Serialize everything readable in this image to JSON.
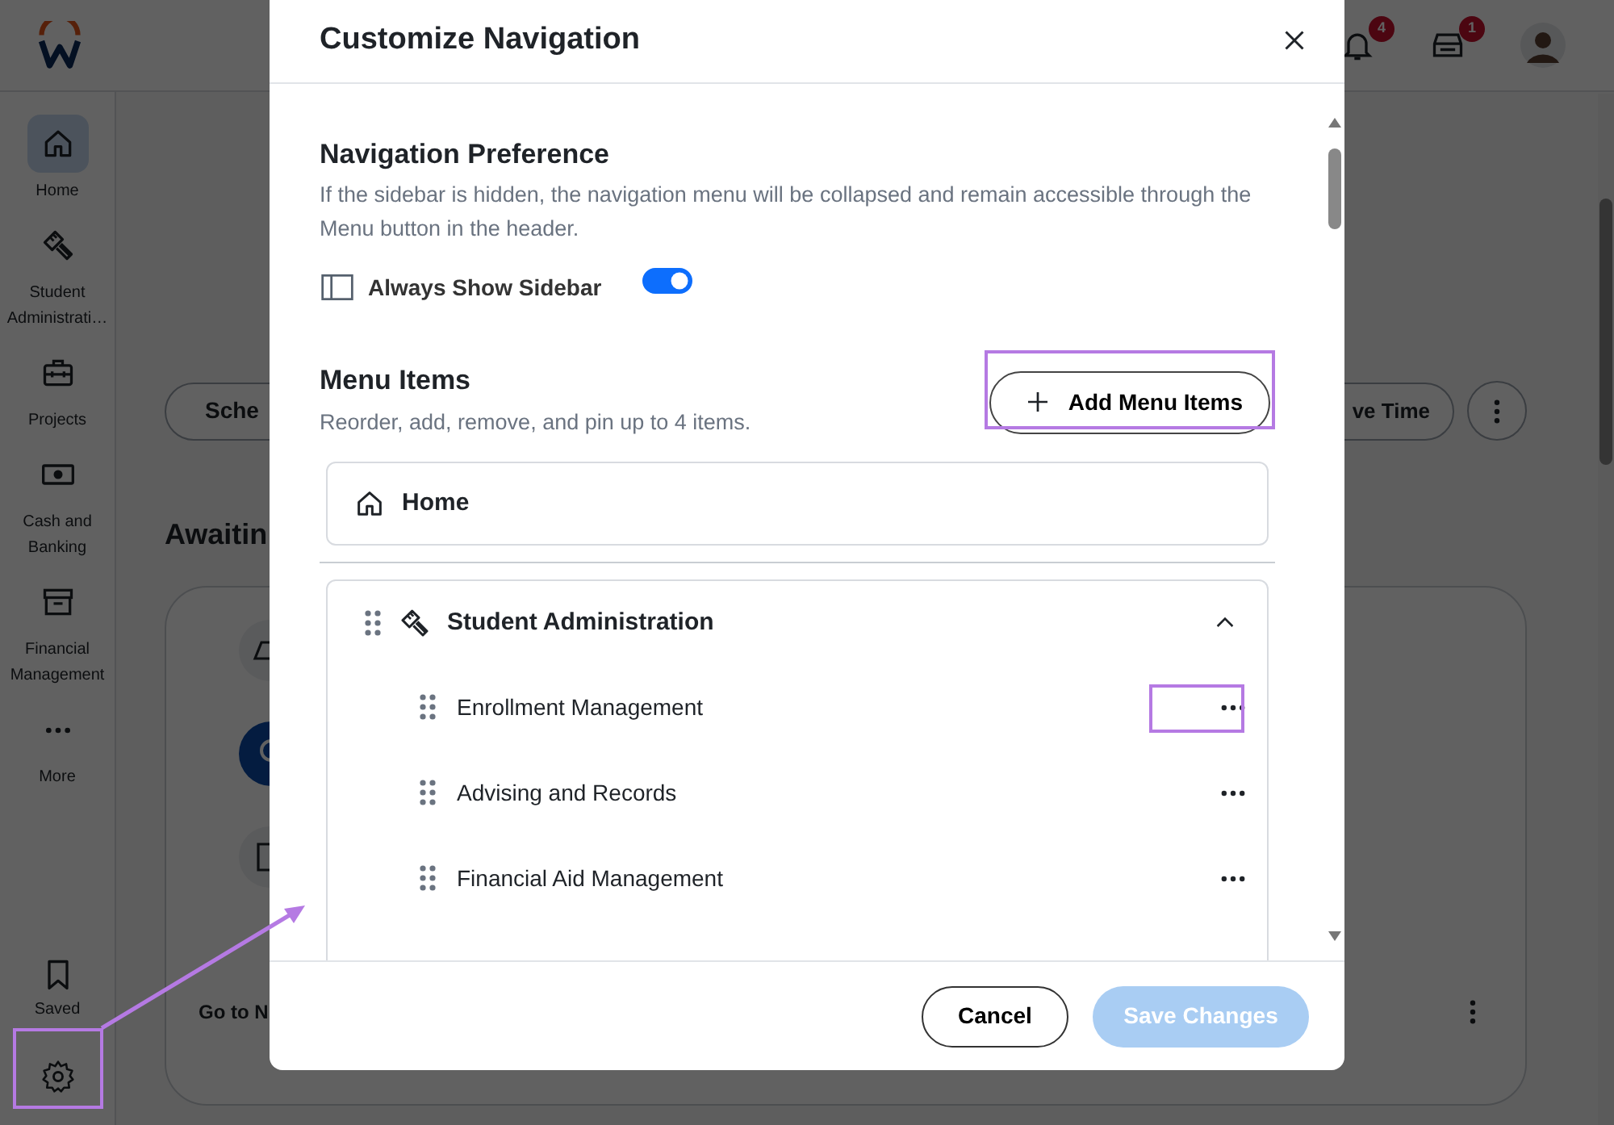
{
  "app": {
    "header": {
      "notification_count": "4",
      "inbox_count": "1"
    },
    "sidebar": {
      "items": [
        {
          "label": "Home",
          "selected": true
        },
        {
          "label": "Student Administrati…",
          "selected": false
        },
        {
          "label": "Projects",
          "selected": false
        },
        {
          "label": "Cash and Banking",
          "selected": false
        },
        {
          "label": "Financial Management",
          "selected": false
        },
        {
          "label": "More",
          "selected": false
        }
      ],
      "bottom_items": [
        {
          "label": "Saved"
        }
      ]
    },
    "content": {
      "left_button": "Sche",
      "right_button": "ve Time",
      "section_title": "Awaitin",
      "card_link": "Go to N"
    }
  },
  "dialog": {
    "title": "Customize Navigation",
    "navigation_preference": {
      "title": "Navigation Preference",
      "description": "If the sidebar is hidden, the navigation menu will be collapsed and remain accessible through the Menu button in the header.",
      "setting": {
        "label": "Always Show Sidebar",
        "on": true
      }
    },
    "menu_items": {
      "title": "Menu Items",
      "description": "Reorder, add, remove, and pin up to 4 items.",
      "add_button": "Add Menu Items",
      "items": [
        {
          "label": "Home",
          "kind": "single"
        },
        {
          "label": "Student Administration",
          "kind": "group",
          "expanded": true,
          "children": [
            {
              "label": "Enrollment Management"
            },
            {
              "label": "Advising and Records"
            },
            {
              "label": "Financial Aid Management"
            }
          ]
        }
      ]
    },
    "buttons": [
      {
        "label": "Cancel",
        "kind": "secondary",
        "disabled": false
      },
      {
        "label": "Save Changes",
        "kind": "primary",
        "disabled": true
      }
    ]
  }
}
